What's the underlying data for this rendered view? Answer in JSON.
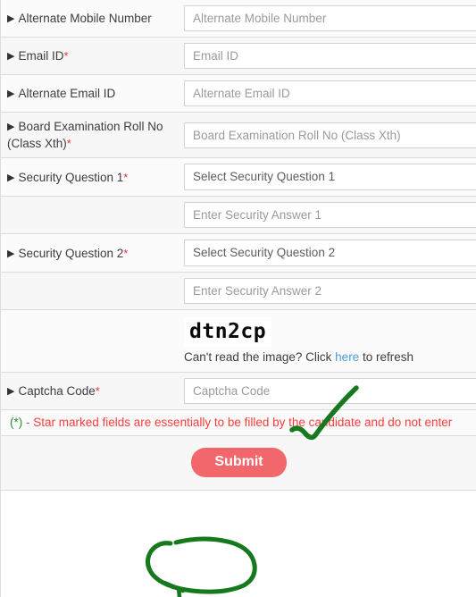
{
  "form": {
    "rows": [
      {
        "id": "alternate-mobile-number",
        "label": "Alternate Mobile Number",
        "required": false,
        "field_type": "text",
        "placeholder": "Alternate Mobile Number",
        "value": ""
      },
      {
        "id": "email-id",
        "label": "Email ID",
        "required": true,
        "field_type": "text",
        "placeholder": "Email ID",
        "value": ""
      },
      {
        "id": "alternate-email-id",
        "label": "Alternate Email ID",
        "required": false,
        "field_type": "text",
        "placeholder": "Alternate Email ID",
        "value": ""
      },
      {
        "id": "board-examination-roll-no",
        "label": "Board Examination Roll No (Class Xth)",
        "required": true,
        "field_type": "text",
        "placeholder": "Board Examination Roll No (Class Xth)",
        "value": ""
      },
      {
        "id": "security-question-1",
        "label": "Security Question 1",
        "required": true,
        "field_type": "select",
        "placeholder": "Select Security Question 1",
        "value": "Select Security Question 1"
      },
      {
        "id": "security-answer-1",
        "label": "",
        "required": false,
        "field_type": "text",
        "placeholder": "Enter Security Answer 1",
        "value": ""
      },
      {
        "id": "security-question-2",
        "label": "Security Question 2",
        "required": true,
        "field_type": "select",
        "placeholder": "Select Security Question 2",
        "value": "Select Security Question 2"
      },
      {
        "id": "security-answer-2",
        "label": "",
        "required": false,
        "field_type": "text",
        "placeholder": "Enter Security Answer 2",
        "value": ""
      }
    ],
    "captcha": {
      "image_text": "dtn2cp",
      "hint_prefix": "Can't read the image? Click ",
      "hint_link": "here",
      "hint_suffix": " to refresh"
    },
    "captcha_code": {
      "id": "captcha-code",
      "label": "Captcha Code",
      "required": true,
      "placeholder": "Captcha Code",
      "value": ""
    },
    "note": {
      "star": "(*)",
      "dash": " - ",
      "text": "Star marked fields are essentially to be filled by the candidate and do not enter"
    },
    "submit": {
      "label": "Submit"
    }
  },
  "colors": {
    "required_star": "#e8323c",
    "note_text": "#fb3c3c",
    "link": "#4a9fd8",
    "submit_background": "#f2676b",
    "submit_text": "#ffffff",
    "annotation": "#17791d",
    "captcha_text": "#0a0a0a",
    "row_border": "#dcdcdc"
  },
  "annotations": {
    "checkmark": "green-check-mark-over-captcha",
    "circle": "green-ellipse-around-submit-button"
  },
  "icons": {
    "bullet": "▶"
  }
}
